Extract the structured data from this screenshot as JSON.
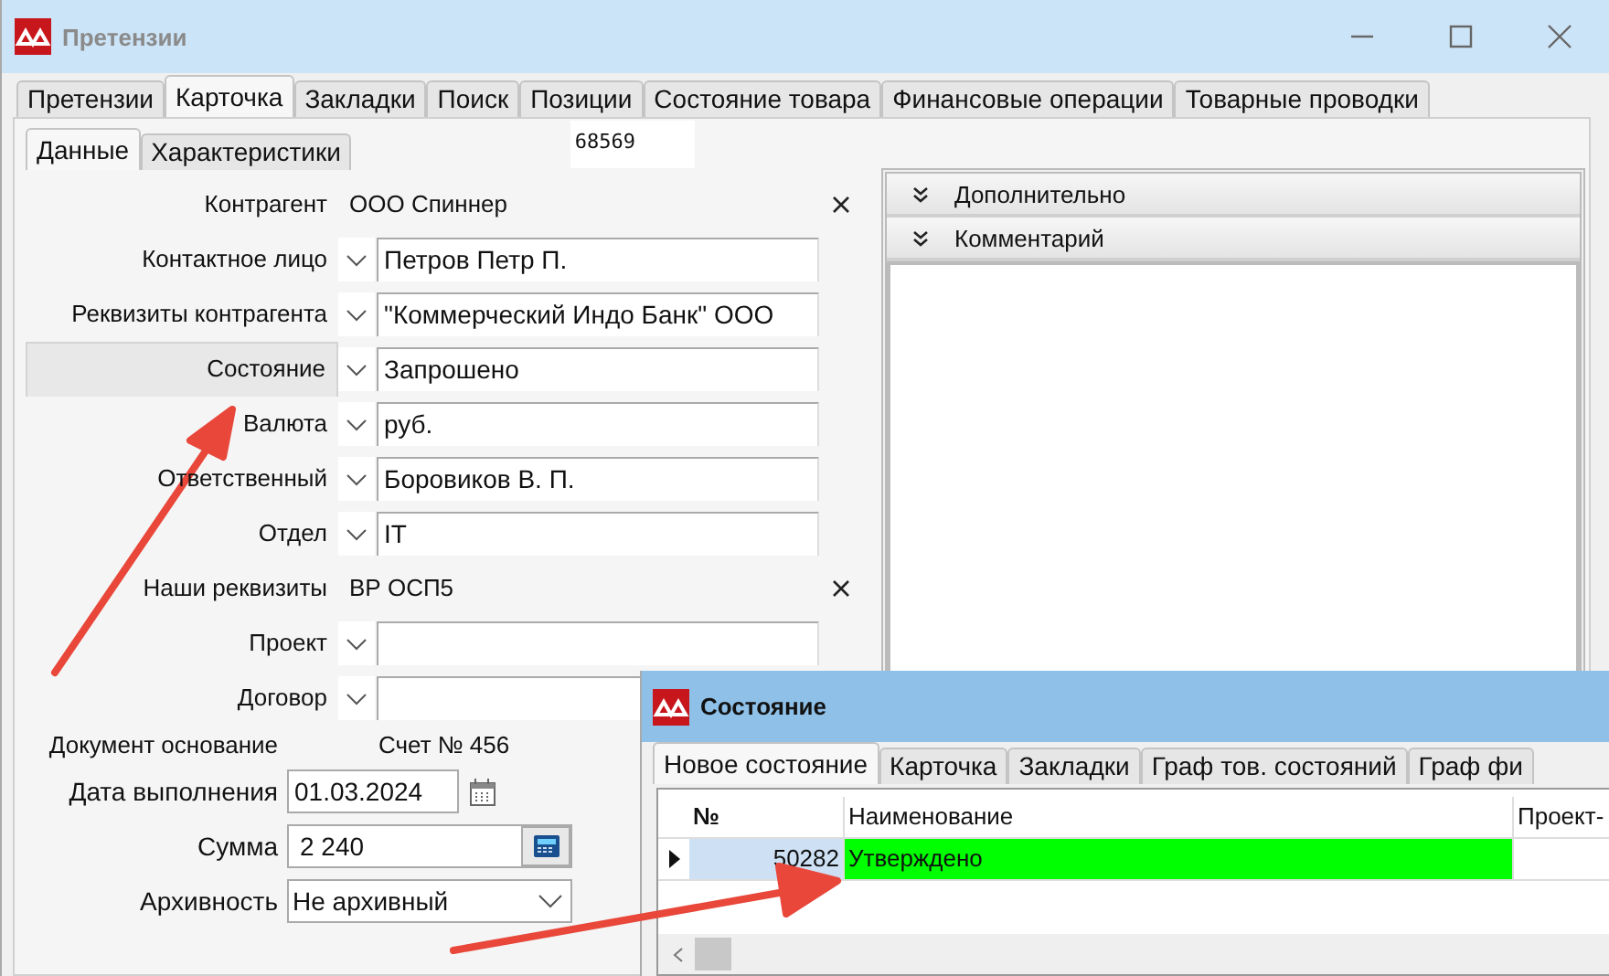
{
  "window": {
    "title": "Претензии"
  },
  "tabs": [
    {
      "label": "Претензии",
      "selected": false
    },
    {
      "label": "Карточка",
      "selected": true
    },
    {
      "label": "Закладки",
      "selected": false
    },
    {
      "label": "Поиск",
      "selected": false
    },
    {
      "label": "Позиции",
      "selected": false
    },
    {
      "label": "Состояние товара",
      "selected": false
    },
    {
      "label": "Финансовые операции",
      "selected": false
    },
    {
      "label": "Товарные проводки",
      "selected": false
    }
  ],
  "subtabs": [
    {
      "label": "Данные",
      "selected": true
    },
    {
      "label": "Характеристики",
      "selected": false
    }
  ],
  "record_id": "68569",
  "fields": [
    {
      "kind": "reference",
      "label": "Контрагент",
      "value": "ООО Спиннер",
      "focused": false
    },
    {
      "kind": "dropdown",
      "label": "Контактное лицо",
      "value": "Петров Петр П.",
      "focused": false
    },
    {
      "kind": "dropdown",
      "label": "Реквизиты контрагента",
      "value": "\"Коммерческий Индо Банк\" ООО",
      "focused": false
    },
    {
      "kind": "dropdown",
      "label": "Состояние",
      "value": "Запрошено",
      "focused": true
    },
    {
      "kind": "dropdown",
      "label": "Валюта",
      "value": "руб.",
      "focused": false
    },
    {
      "kind": "dropdown",
      "label": "Ответственный",
      "value": "Боровиков В. П.",
      "focused": false
    },
    {
      "kind": "dropdown",
      "label": "Отдел",
      "value": "IT",
      "focused": false
    },
    {
      "kind": "reference",
      "label": "Наши реквизиты",
      "value": "ВР ОСП5",
      "focused": false
    },
    {
      "kind": "dropdown",
      "label": "Проект",
      "focused": false
    },
    {
      "kind": "dropdown",
      "label": "Договор",
      "focused": false
    }
  ],
  "lower_fields": [
    {
      "kind": "text",
      "label": "Документ основание",
      "value": "Счет № 456"
    },
    {
      "kind": "date",
      "label": "Дата выполнения",
      "value": "01.03.2024"
    },
    {
      "kind": "amount",
      "label": "Сумма",
      "value": "2 240"
    },
    {
      "kind": "select",
      "label": "Архивность",
      "value": "Не архивный"
    }
  ],
  "side_panels": [
    {
      "kind": "header",
      "title": "Дополнительно"
    },
    {
      "kind": "memo",
      "title": "Комментарий"
    }
  ],
  "popup": {
    "title": "Состояние",
    "tabs": [
      {
        "label": "Новое состояние",
        "selected": true
      },
      {
        "label": "Карточка",
        "selected": false
      },
      {
        "label": "Закладки",
        "selected": false
      },
      {
        "label": "Граф тов. состояний",
        "selected": false
      },
      {
        "label": "Граф фи",
        "selected": false
      }
    ],
    "columns": [
      "№",
      "Наименование",
      "Проект-"
    ],
    "rows": [
      {
        "number": "50282",
        "name": "Утверждено",
        "color": "#00ff00",
        "current": true
      }
    ]
  }
}
